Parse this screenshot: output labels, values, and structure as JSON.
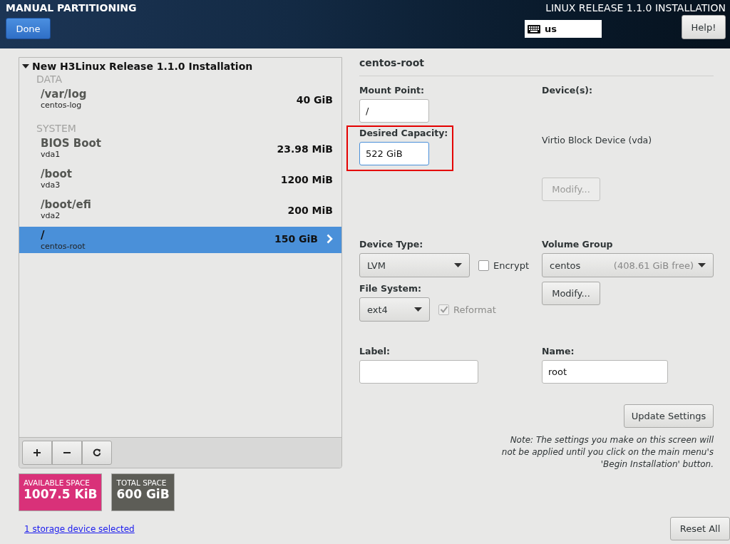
{
  "header": {
    "title": "MANUAL PARTITIONING",
    "product": "LINUX RELEASE 1.1.0 INSTALLATION",
    "done_button": "Done",
    "keyboard": {
      "layout": "us"
    },
    "help_button": "Help!"
  },
  "tree": {
    "label": "New H3Linux Release 1.1.0 Installation",
    "expanded": true,
    "groups": [
      {
        "name": "DATA",
        "items": [
          {
            "mount": "/var/log",
            "device": "centos-log",
            "size": "40 GiB",
            "selected": false
          }
        ]
      },
      {
        "name": "SYSTEM",
        "items": [
          {
            "mount": "BIOS Boot",
            "device": "vda1",
            "size": "23.98 MiB",
            "selected": false
          },
          {
            "mount": "/boot",
            "device": "vda3",
            "size": "1200 MiB",
            "selected": false
          },
          {
            "mount": "/boot/efi",
            "device": "vda2",
            "size": "200 MiB",
            "selected": false
          },
          {
            "mount": "/",
            "device": "centos-root",
            "size": "150 GiB",
            "selected": true
          }
        ]
      }
    ]
  },
  "toolbar": [
    {
      "kind": "add"
    },
    {
      "kind": "remove"
    },
    {
      "kind": "refresh"
    }
  ],
  "space": [
    {
      "label": "AVAILABLE SPACE",
      "value": "1007.5 KiB",
      "color": "#d93179"
    },
    {
      "label": "TOTAL SPACE",
      "value": "600 GiB",
      "color": "#5d5d57"
    }
  ],
  "storage_link": "1 storage device selected",
  "details": {
    "title": "centos-root",
    "mount_point": {
      "label": "Mount Point:",
      "value": "/"
    },
    "capacity": {
      "label": "Desired Capacity:",
      "value": "522 GiB",
      "highlighted": true,
      "focused": true
    },
    "devices": {
      "label": "Device(s):",
      "value": "Virtio Block Device (vda)"
    },
    "device_modify": {
      "label": "Modify...",
      "disabled": true
    },
    "device_type": {
      "label": "Device Type:",
      "value": "LVM"
    },
    "encrypt": {
      "label": "Encrypt",
      "checked": false,
      "disabled": false
    },
    "file_system": {
      "label": "File System:",
      "value": "ext4"
    },
    "reformat": {
      "label": "Reformat",
      "checked": true,
      "disabled": true
    },
    "volume_group": {
      "label": "Volume Group",
      "value": "centos",
      "free": "(408.61 GiB free)"
    },
    "vg_modify": {
      "label": "Modify...",
      "disabled": false
    },
    "label_field": {
      "label": "Label:"
    },
    "name_field": {
      "label": "Name:",
      "value": "root"
    },
    "update_button": "Update Settings",
    "note": "Note:  The settings you make on this screen will not be applied until you click on the main menu's 'Begin Installation' button.",
    "reset_button": "Reset All"
  }
}
